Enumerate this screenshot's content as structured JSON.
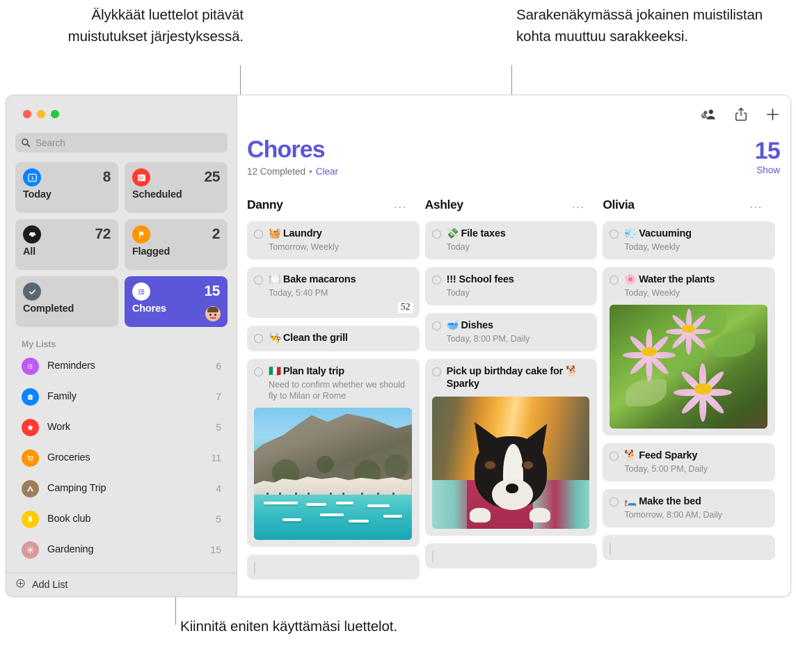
{
  "callouts": {
    "top_left": "Älykkäät luettelot pitävät muistutukset järjestyksessä.",
    "top_right": "Sarakenäkymässä jokainen muistilistan kohta muuttuu sarakkeeksi.",
    "bottom": "Kiinnitä eniten käyttämäsi luettelot."
  },
  "colors": {
    "accent_purple": "#5b57d8",
    "sidebar_bg": "#e6e6e6",
    "tile_bg": "#d3d3d3",
    "card_bg": "#e8e8e8",
    "traffic_red": "#ff5f57",
    "traffic_yellow": "#febc2e",
    "traffic_green": "#28c840"
  },
  "window": {
    "traffic_lights": [
      "close",
      "minimize",
      "zoom"
    ]
  },
  "sidebar": {
    "search": {
      "placeholder": "Search",
      "value": "",
      "icon": "search-icon"
    },
    "smart_lists": [
      {
        "label": "Today",
        "count": "8",
        "icon": "today-calendar-icon",
        "color": "#0a84ff",
        "selected": false
      },
      {
        "label": "Scheduled",
        "count": "25",
        "icon": "scheduled-calendar-icon",
        "color": "#ff3b30",
        "selected": false
      },
      {
        "label": "All",
        "count": "72",
        "icon": "all-inbox-icon",
        "color": "#1c1c1e",
        "selected": false
      },
      {
        "label": "Flagged",
        "count": "2",
        "icon": "flag-icon",
        "color": "#ff9500",
        "selected": false
      },
      {
        "label": "Completed",
        "count": "",
        "icon": "checkmark-icon",
        "color": "#5b6670",
        "selected": false
      },
      {
        "label": "Chores",
        "count": "15",
        "icon": "list-bullets-icon",
        "color": "#ffffff",
        "selected": true,
        "has_avatar": true
      }
    ],
    "my_lists_header": "My Lists",
    "my_lists": [
      {
        "label": "Reminders",
        "count": "6",
        "icon": "list-bullets-icon",
        "color": "#bf5af2"
      },
      {
        "label": "Family",
        "count": "7",
        "icon": "house-icon",
        "color": "#0a84ff"
      },
      {
        "label": "Work",
        "count": "5",
        "icon": "star-icon",
        "color": "#ff3b30"
      },
      {
        "label": "Groceries",
        "count": "11",
        "icon": "cart-icon",
        "color": "#ff9500"
      },
      {
        "label": "Camping Trip",
        "count": "4",
        "icon": "tent-icon",
        "color": "#9b7f5d"
      },
      {
        "label": "Book club",
        "count": "5",
        "icon": "bookmark-icon",
        "color": "#ffcc00"
      },
      {
        "label": "Gardening",
        "count": "15",
        "icon": "sun-icon",
        "color": "#d99a9a"
      }
    ],
    "add_list": {
      "label": "Add List",
      "icon": "plus-circle-icon"
    }
  },
  "main": {
    "toolbar": [
      {
        "name": "share-participants-icon",
        "label": "Shared"
      },
      {
        "name": "share-icon",
        "label": "Share"
      },
      {
        "name": "plus-icon",
        "label": "New Reminder"
      }
    ],
    "title": "Chores",
    "completed_text": "12 Completed",
    "separator": "•",
    "clear_label": "Clear",
    "count": "15",
    "show_label": "Show",
    "columns": [
      {
        "name": "Danny",
        "more": "...",
        "items": [
          {
            "emoji": "🧺",
            "title": "Laundry",
            "sub": "Tomorrow, Weekly"
          },
          {
            "emoji": "🍽️",
            "title": "Bake macarons",
            "sub": "Today, 5:40 PM",
            "badge": "52"
          },
          {
            "emoji": "👨‍🍳",
            "title": "Clean the grill",
            "sub": ""
          },
          {
            "emoji": "🇮🇹",
            "title": "Plan Italy trip",
            "note": "Need to confirm whether we should fly to Milan or Rome",
            "photo": "italy-coast-photo"
          },
          {
            "emoji": "",
            "title": "",
            "sub": "",
            "empty": true
          }
        ]
      },
      {
        "name": "Ashley",
        "more": "...",
        "items": [
          {
            "emoji": "💸",
            "title": "File taxes",
            "sub": "Today"
          },
          {
            "emoji": "",
            "title": "!!! School fees",
            "sub": "Today"
          },
          {
            "emoji": "🥣",
            "title": "Dishes",
            "sub": "Today, 8:00 PM, Daily"
          },
          {
            "emoji": "",
            "title": "Pick up birthday cake for 🐕 Sparky",
            "photo": "dog-sparky-photo"
          },
          {
            "emoji": "",
            "title": "",
            "sub": "",
            "empty": true
          }
        ]
      },
      {
        "name": "Olivia",
        "more": "...",
        "items": [
          {
            "emoji": "💨",
            "title": "Vacuuming",
            "sub": "Today, Weekly"
          },
          {
            "emoji": "🌸",
            "title": "Water the plants",
            "sub": "Today, Weekly",
            "photo": "pink-flowers-photo"
          },
          {
            "emoji": "🐕",
            "title": "Feed Sparky",
            "sub": "Today, 5:00 PM, Daily"
          },
          {
            "emoji": "🛏️",
            "title": "Make the bed",
            "sub": "Tomorrow, 8:00 AM, Daily"
          },
          {
            "emoji": "",
            "title": "",
            "sub": "",
            "empty": true
          }
        ]
      }
    ]
  }
}
